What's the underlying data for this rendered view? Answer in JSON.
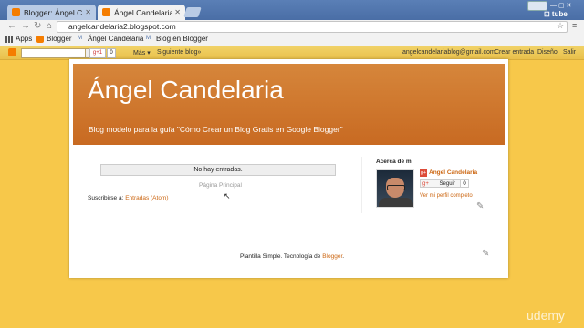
{
  "browser": {
    "tabs": [
      {
        "label": "Blogger: Ángel Cande",
        "active": false
      },
      {
        "label": "Ángel Candelaria",
        "active": true
      }
    ],
    "url": "angelcandelaria2.blogspot.com",
    "bookmarks": [
      "Apps",
      "Blogger",
      "Ángel Candelaria",
      "Blog en Blogger"
    ]
  },
  "navbar": {
    "gplus_label": "g+1",
    "gplus_count": "0",
    "more_label": "Más",
    "next_blog_label": "Siguiente blog»",
    "email": "angelcandelariablog@gmail.com",
    "create_label": "Crear entrada",
    "design_label": "Diseño",
    "signout_label": "Salir"
  },
  "blog": {
    "title": "Ángel Candelaria",
    "description": "Blog modelo para la guía \"Cómo Crear un Blog Gratis en Google Blogger\"",
    "no_posts": "No hay entradas.",
    "home_link": "Página Principal",
    "subscribe_label": "Suscribirse a:",
    "subscribe_link": "Entradas (Atom)"
  },
  "about": {
    "heading": "Acerca de mí",
    "name": "Ángel Candelaria",
    "follow_label": "Seguir",
    "follow_count": "0",
    "view_profile": "Ver mi perfil completo"
  },
  "footer": {
    "text": "Plantilla Simple. Tecnología de ",
    "link": "Blogger",
    "suffix": "."
  },
  "watermark": "udemy",
  "colors": {
    "header": "#c86a22",
    "link": "#cc6611",
    "navbar": "#e9c04b",
    "background": "#f7c84a"
  }
}
